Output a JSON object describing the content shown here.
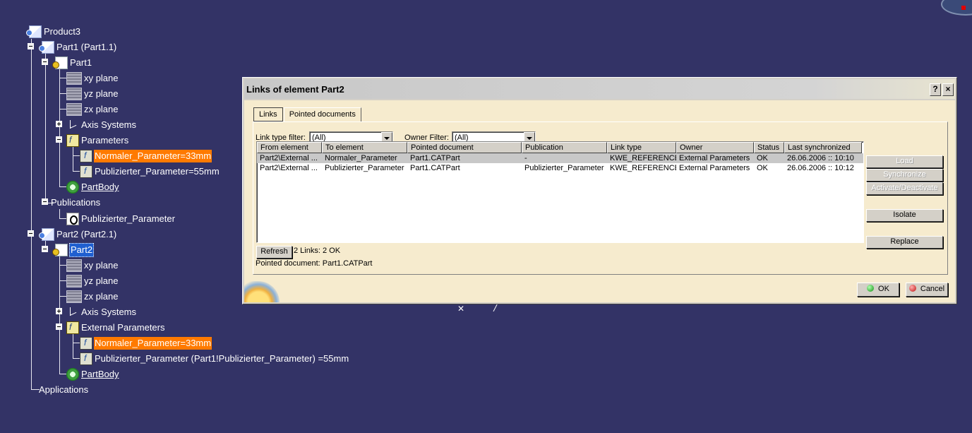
{
  "tree": {
    "product": "Product3",
    "part1_instance": "Part1 (Part1.1)",
    "part1": "Part1",
    "part1_children": {
      "xy": "xy plane",
      "yz": "yz plane",
      "zx": "zx plane",
      "axis": "Axis Systems",
      "parameters": "Parameters",
      "param_normal": "Normaler_Parameter=33mm",
      "param_publ": "Publizierter_Parameter=55mm",
      "partbody": "PartBody"
    },
    "publications": "Publications",
    "publication_item": "Publizierter_Parameter",
    "part2_instance": "Part2 (Part2.1)",
    "part2": "Part2",
    "part2_children": {
      "xy": "xy plane",
      "yz": "yz plane",
      "zx": "zx plane",
      "axis": "Axis Systems",
      "ext_parameters": "External Parameters",
      "param_normal": "Normaler_Parameter=33mm",
      "param_publ": "Publizierter_Parameter (Part1!Publizierter_Parameter) =55mm",
      "partbody": "PartBody"
    },
    "applications": "Applications"
  },
  "dialog": {
    "title": "Links of element Part2",
    "help": "?",
    "close": "×",
    "tabs": [
      "Links",
      "Pointed documents"
    ],
    "link_type_filter_label": "Link type filter:",
    "link_type_filter_value": "(All)",
    "owner_filter_label": "Owner Filter:",
    "owner_filter_value": "(All)",
    "columns": [
      "From element",
      "To element",
      "Pointed document",
      "Publication",
      "Link type",
      "Owner",
      "Status",
      "Last synchronized"
    ],
    "rows": [
      [
        "Part2\\External ...",
        "Normaler_Parameter",
        "Part1.CATPart",
        "-",
        "KWE_REFERENCE",
        "External Parameters",
        "OK",
        "26.06.2006 :: 10:10"
      ],
      [
        "Part2\\External ...",
        "Publizierter_Parameter",
        "Part1.CATPart",
        "Publizierter_Parameter",
        "KWE_REFERENCE",
        "External Parameters",
        "OK",
        "26.06.2006 :: 10:12"
      ]
    ],
    "refresh": "Refresh",
    "links_status": "2 Links: 2 OK",
    "pointed_document": "Pointed document: Part1.CATPart",
    "side_buttons": {
      "load": "Load",
      "synchronize": "Synchronize",
      "activate": "Activate/Deactivate",
      "isolate": "Isolate",
      "replace": "Replace"
    },
    "ok": "OK",
    "cancel": "Cancel"
  },
  "colors": {
    "background": "#333366",
    "highlight": "#ff7a00",
    "selection": "#1f5fd0"
  }
}
